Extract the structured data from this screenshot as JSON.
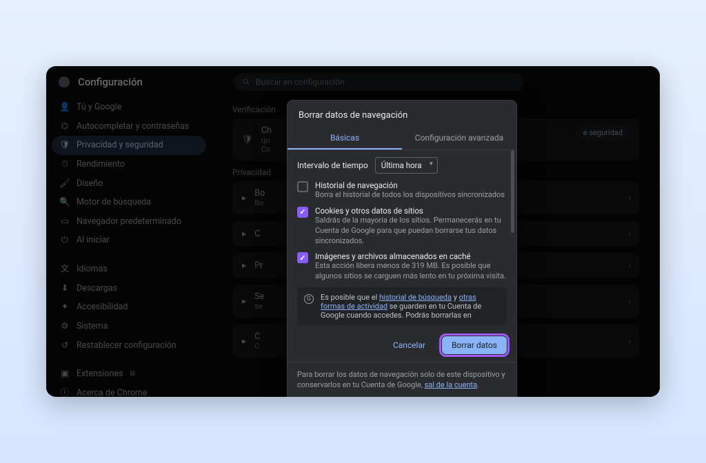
{
  "header": {
    "title": "Configuración",
    "search_placeholder": "Buscar en configuración"
  },
  "sidebar": {
    "items": [
      {
        "label": "Tú y Google",
        "icon": "person"
      },
      {
        "label": "Autocompletar y contraseñas",
        "icon": "key"
      },
      {
        "label": "Privacidad y seguridad",
        "icon": "shield",
        "active": true
      },
      {
        "label": "Rendimiento",
        "icon": "speed"
      },
      {
        "label": "Diseño",
        "icon": "brush"
      },
      {
        "label": "Motor de búsqueda",
        "icon": "search"
      },
      {
        "label": "Navegador predeterminado",
        "icon": "window"
      },
      {
        "label": "Al iniciar",
        "icon": "power"
      }
    ],
    "secondary": [
      {
        "label": "Idiomas",
        "icon": "lang"
      },
      {
        "label": "Descargas",
        "icon": "download"
      },
      {
        "label": "Accesibilidad",
        "icon": "a11y"
      },
      {
        "label": "Sistema",
        "icon": "system"
      },
      {
        "label": "Restablecer configuración",
        "icon": "reset"
      }
    ],
    "footer": [
      {
        "label": "Extensiones",
        "icon": "ext",
        "external": true
      },
      {
        "label": "Acerca de Chrome",
        "icon": "about"
      }
    ]
  },
  "content": {
    "section1_label": "Verificación",
    "check_card": {
      "title": "Ch",
      "sub": "qu",
      "line": "Co",
      "pill": "e seguridad"
    },
    "section2_label": "Privacidad",
    "cards": [
      {
        "icon": "trash",
        "title": "Bo",
        "sub": "Bo"
      },
      {
        "icon": "cookie",
        "title": "C",
        "sub": ""
      },
      {
        "icon": "priv",
        "title": "Pr",
        "sub": ""
      },
      {
        "icon": "lock",
        "title": "Se",
        "sub": "se"
      },
      {
        "icon": "site",
        "title": "C",
        "sub": "C"
      }
    ]
  },
  "modal": {
    "title": "Borrar datos de navegación",
    "tabs": {
      "basic": "Básicas",
      "advanced": "Configuración avanzada"
    },
    "time_label": "Intervalo de tiempo",
    "time_value": "Última hora",
    "options": [
      {
        "checked": false,
        "title": "Historial de navegación",
        "desc": "Borra el historial de todos los dispositivos sincronizados"
      },
      {
        "checked": true,
        "title": "Cookies y otros datos de sitios",
        "desc": "Saldrás de la mayoría de los sitios. Permanecerás en tu Cuenta de Google para que puedan borrarse tus datos sincronizados."
      },
      {
        "checked": true,
        "title": "Imágenes y archivos almacenados en caché",
        "desc": "Esta acción libera menos de 319 MB. Es posible que algunos sitios se carguen más lento en tu próxima visita."
      }
    ],
    "info_pre": "Es posible que el ",
    "info_link1": "historial de búsqueda",
    "info_mid": " y ",
    "info_link2": "otras formas de actividad",
    "info_post": " se guarden en tu Cuenta de Google cuando accedes. Podrás borrarlas en",
    "cancel": "Cancelar",
    "confirm": "Borrar datos",
    "footer_text": "Para borrar los datos de navegación solo de este dispositivo y conservarlos en tu Cuenta de Google, ",
    "footer_link": "sal de la cuenta",
    "footer_post": "."
  }
}
